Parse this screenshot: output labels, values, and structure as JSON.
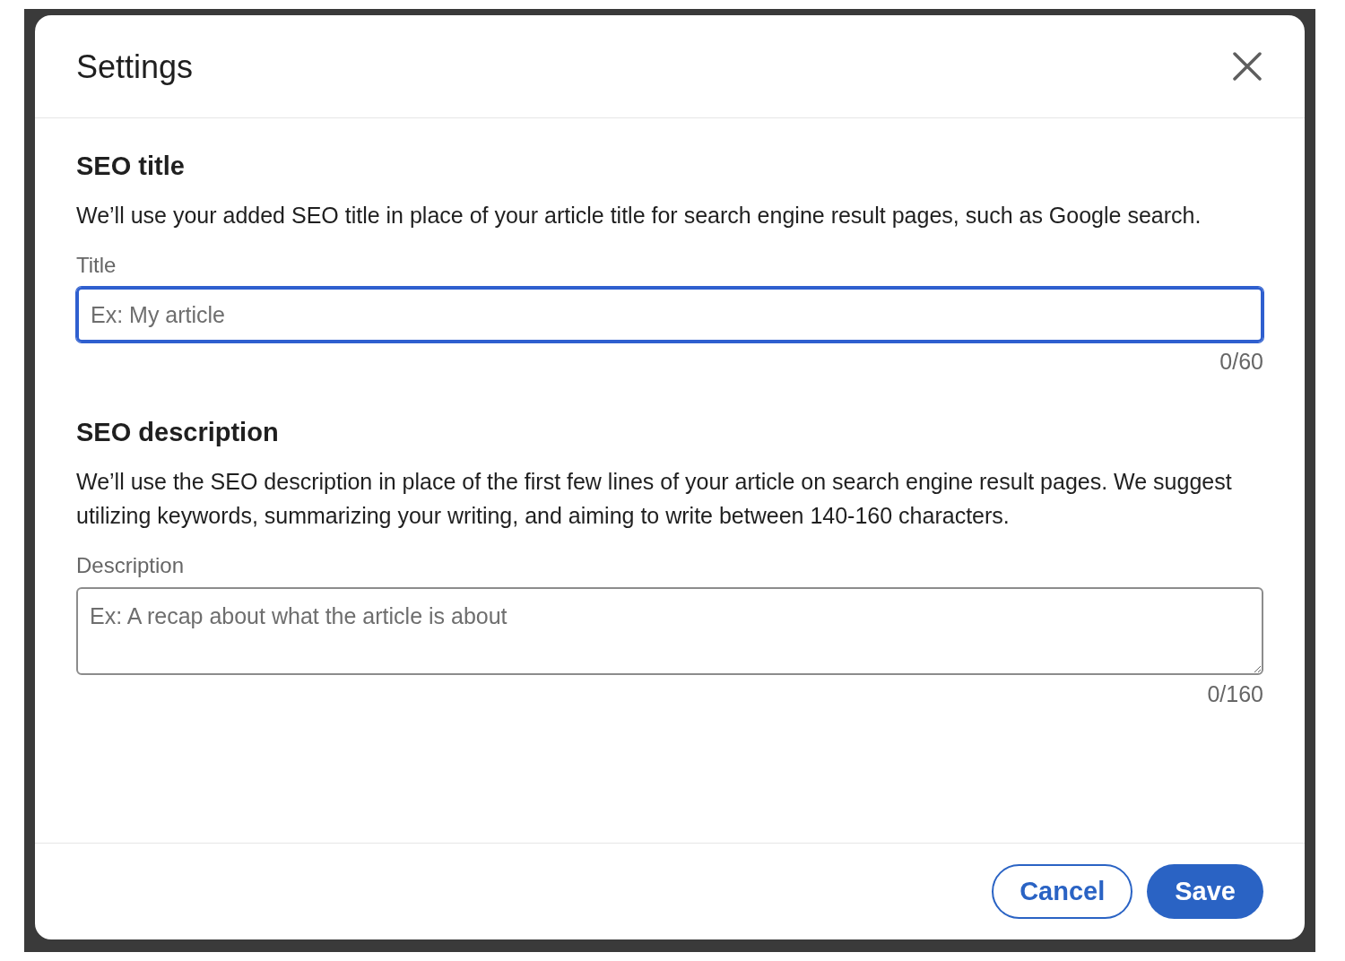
{
  "dialog": {
    "title": "Settings"
  },
  "sections": [
    {
      "heading": "SEO title",
      "description": "We’ll use your added SEO title in place of your article title for search engine result pages, such as Google search.",
      "field": {
        "kind": "input",
        "label": "Title",
        "placeholder": "Ex: My article",
        "focused": true,
        "counter": "0/60"
      }
    },
    {
      "heading": "SEO description",
      "description": "We’ll use the SEO description in place of the first few lines of your article on search engine result pages. We suggest utilizing keywords, summarizing your writing, and aiming to write between 140-160 characters.",
      "field": {
        "kind": "textarea",
        "label": "Description",
        "placeholder": "Ex: A recap about what the article is about",
        "focused": false,
        "counter": "0/160"
      }
    }
  ],
  "buttons": [
    {
      "label": "Cancel",
      "kind": "secondary"
    },
    {
      "label": "Save",
      "kind": "primary"
    }
  ]
}
